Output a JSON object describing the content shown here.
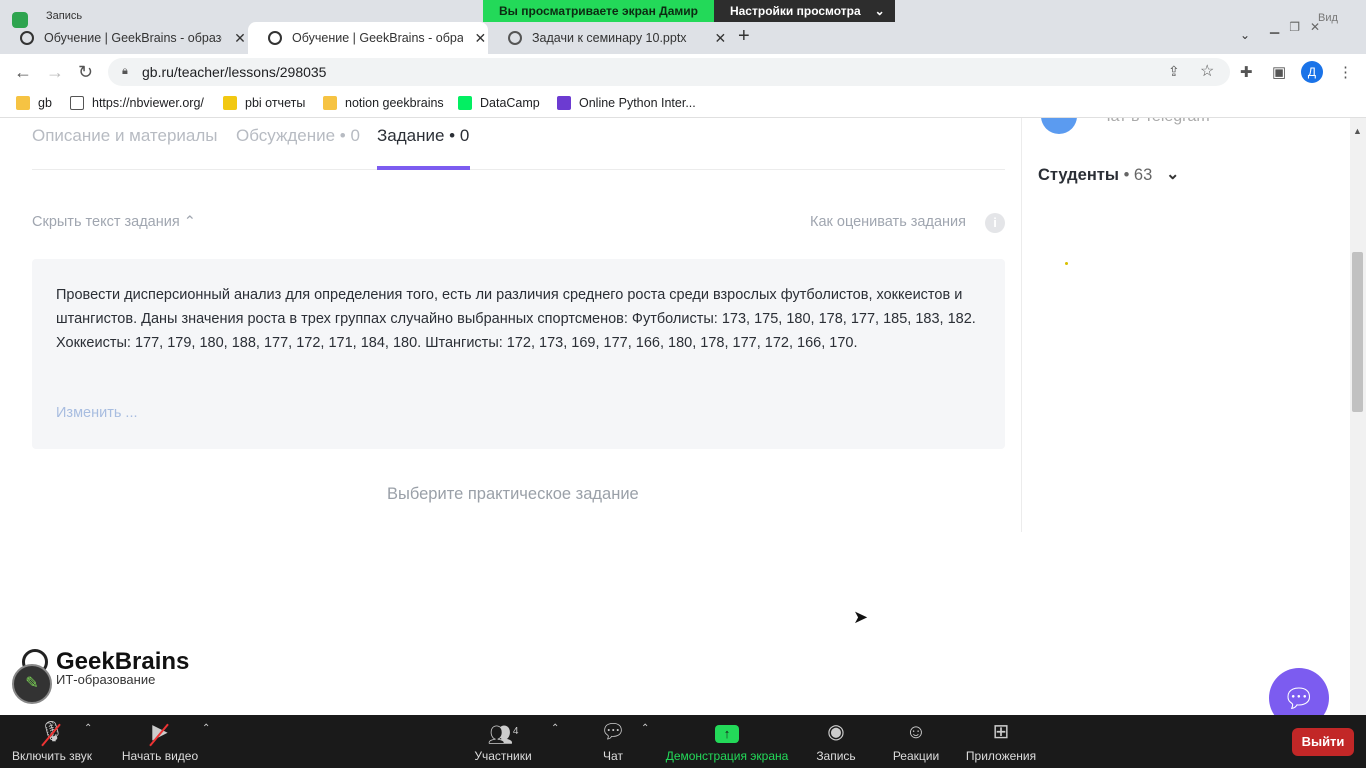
{
  "zoom_banner": {
    "viewing_text": "Вы просматриваете экран Дамир",
    "settings_text": "Настройки просмотра"
  },
  "recording_label": "Запись",
  "browser": {
    "tabs": [
      {
        "title": "Обучение | GeekBrains - образо",
        "active": false
      },
      {
        "title": "Обучение | GeekBrains - образо",
        "active": true
      },
      {
        "title": "Задачи к семинару 10.pptx",
        "active": false
      }
    ],
    "window_label": "Вид",
    "url": "gb.ru/teacher/lessons/298035",
    "profile_initial": "Д",
    "bookmarks": [
      {
        "label": "gb",
        "icon": "folder-icon",
        "color": "#f6c343"
      },
      {
        "label": "https://nbviewer.org/",
        "icon": "nbviewer-icon",
        "color": "#555555"
      },
      {
        "label": "pbi отчеты",
        "icon": "pbi-icon",
        "color": "#f2c811"
      },
      {
        "label": "notion geekbrains",
        "icon": "folder-icon",
        "color": "#f6c343"
      },
      {
        "label": "DataCamp",
        "icon": "datacamp-icon",
        "color": "#03ef62"
      },
      {
        "label": "Online Python Inter...",
        "icon": "python-icon",
        "color": "#6c3bd1"
      }
    ]
  },
  "lesson": {
    "tabs": [
      {
        "label": "Описание и материалы"
      },
      {
        "label": "Обсуждение • 0"
      },
      {
        "label": "Задание • 0"
      }
    ],
    "hide_text_label": "Скрыть текст задания",
    "how_to_grade_label": "Как оценивать задания",
    "task_text": "Провести дисперсионный анализ для определения того, есть ли различия среднего роста среди взрослых футболистов, хоккеистов и штангистов. Даны значения роста в трех группах случайно выбранных спортсменов: Футболисты: 173, 175, 180, 178, 177, 185, 183, 182. Хоккеисты: 177, 179, 180, 188, 177, 172, 171, 184, 180. Штангисты: 172, 173, 169, 177, 166, 180, 178, 177, 172, 166, 170.",
    "edit_link": "Изменить ...",
    "choose_task": "Выберите практическое задание"
  },
  "sidebar": {
    "telegram_label": "Чат в Telegram",
    "students_label": "Студенты",
    "students_count": "• 63"
  },
  "brand": {
    "name": "GeekBrains",
    "tagline": "ИТ-образование"
  },
  "zoom_controls": {
    "unmute": "Включить звук",
    "start_video": "Начать видео",
    "participants": "Участники",
    "participants_count": "4",
    "chat": "Чат",
    "share_screen": "Демонстрация экрана",
    "record": "Запись",
    "reactions": "Реакции",
    "apps": "Приложения",
    "exit": "Выйти"
  },
  "colors": {
    "accent": "#7c5cf0",
    "zoom_green": "#23d959",
    "exit_red": "#c22727"
  }
}
